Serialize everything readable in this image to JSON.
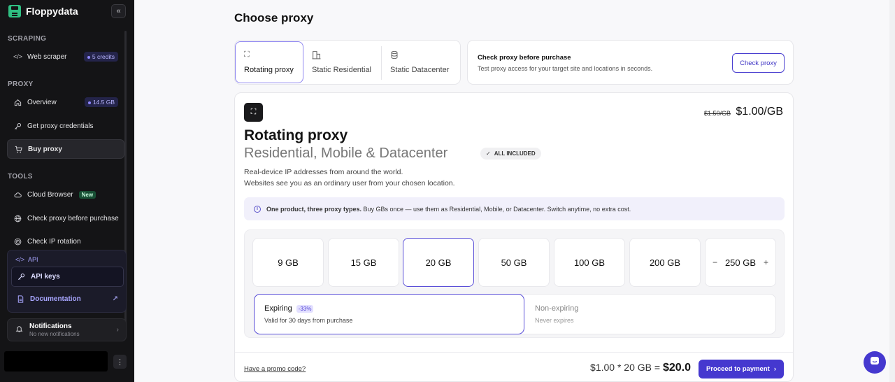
{
  "sidebar": {
    "brand": "Floppydata",
    "sections": {
      "scraping": "SCRAPING",
      "proxy": "PROXY",
      "tools": "TOOLS"
    },
    "items": {
      "web_scraper": {
        "label": "Web scraper",
        "badge": "5 credits"
      },
      "overview": {
        "label": "Overview",
        "badge": "14.5 GB"
      },
      "credentials": {
        "label": "Get proxy credentials"
      },
      "buy_proxy": {
        "label": "Buy proxy"
      },
      "cloud_browser": {
        "label": "Cloud Browser",
        "badge": "New"
      },
      "check_proxy": {
        "label": "Check proxy before purchase"
      },
      "check_ip": {
        "label": "Check IP rotation"
      }
    },
    "api": {
      "label": "API",
      "keys": "API keys",
      "docs": "Documentation"
    },
    "notifications": {
      "title": "Notifications",
      "subtitle": "No new notifications"
    }
  },
  "main": {
    "title": "Choose proxy",
    "tabs": [
      "Rotating proxy",
      "Static Residential",
      "Static Datacenter"
    ],
    "check_card": {
      "title": "Check proxy before purchase",
      "desc": "Test proxy access for your target site and locations in seconds.",
      "button": "Check proxy"
    },
    "product": {
      "old_price": "$1.50/GB",
      "new_price": "$1.00/GB",
      "name": "Rotating proxy",
      "subtitle": "Residential, Mobile & Datacenter",
      "badge": "ALL INCLUDED",
      "desc1": "Real-device IP addresses from around the world.",
      "desc2": "Websites see you as an ordinary user from your chosen location.",
      "info_bold": "One product, three proxy types.",
      "info_rest": " Buy GBs once — use them as Residential, Mobile, or Datacenter. Switch anytime, no extra cost."
    },
    "gb_options": [
      "9 GB",
      "15 GB",
      "20 GB",
      "50 GB",
      "100 GB",
      "200 GB"
    ],
    "gb_custom": {
      "minus": "−",
      "value": "250 GB",
      "plus": "+"
    },
    "expiry": {
      "expiring": {
        "title": "Expiring",
        "badge": "-33%",
        "sub": "Valid for 30 days from purchase"
      },
      "non_expiring": {
        "title": "Non-expiring",
        "sub": "Never expires"
      }
    },
    "footer": {
      "promo": "Have a promo code?",
      "expr": "$1.00 * 20 GB = ",
      "total": "$20.0",
      "button": "Proceed to payment"
    }
  },
  "colors": {
    "accent": "#4538cf",
    "sidebar_bg": "#141416",
    "brand_green": "#2fbf82"
  }
}
